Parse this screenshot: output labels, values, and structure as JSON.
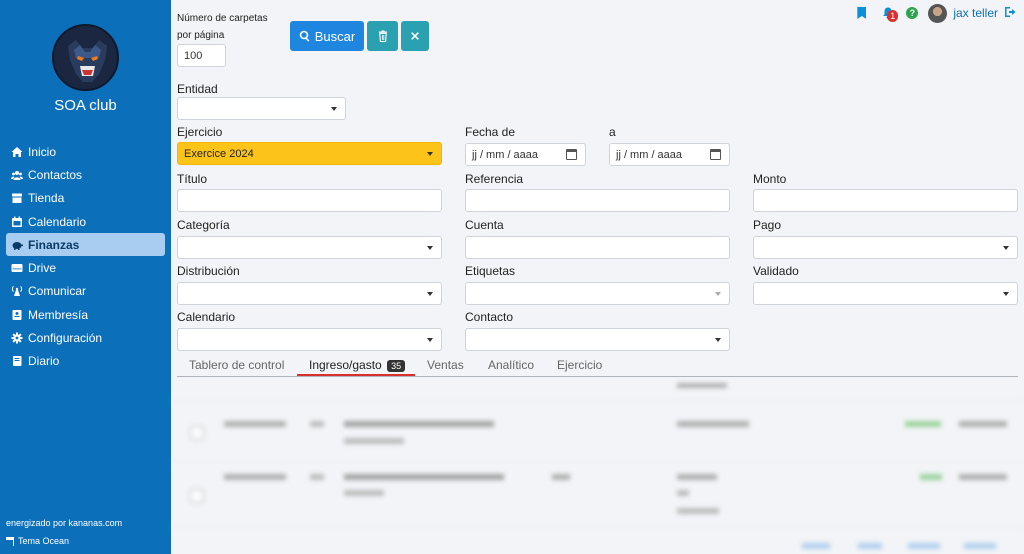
{
  "sidebar": {
    "club_name": "SOA club",
    "items": [
      {
        "label": "Inicio",
        "icon": "home-icon"
      },
      {
        "label": "Contactos",
        "icon": "users-icon"
      },
      {
        "label": "Tienda",
        "icon": "store-icon"
      },
      {
        "label": "Calendario",
        "icon": "calendar-icon"
      },
      {
        "label": "Finanzas",
        "icon": "piggy-bank-icon",
        "active": true
      },
      {
        "label": "Drive",
        "icon": "hdd-icon"
      },
      {
        "label": "Comunicar",
        "icon": "broadcast-icon"
      },
      {
        "label": "Membresía",
        "icon": "id-card-icon"
      },
      {
        "label": "Configuración",
        "icon": "gear-icon"
      },
      {
        "label": "Diario",
        "icon": "book-icon"
      }
    ],
    "powered_by": "energizado por kananas.com",
    "theme": "Tema Ocean"
  },
  "topbar": {
    "notifications_count": "1",
    "help": "?",
    "user_name": "jax teller"
  },
  "filters": {
    "per_page_label": "Número de carpetas por página",
    "per_page_line1": "Número de carpetas",
    "per_page_line2": "por página",
    "per_page_value": "100",
    "search_button": "Buscar",
    "entidad_label": "Entidad",
    "ejercicio_label": "Ejercicio",
    "ejercicio_value": "Exercice 2024",
    "fecha_de_label": "Fecha de",
    "fecha_de_placeholder": "jj / mm / aaaa",
    "a_label": "a",
    "a_placeholder": "jj / mm / aaaa",
    "titulo_label": "Título",
    "referencia_label": "Referencia",
    "monto_label": "Monto",
    "categoria_label": "Categoría",
    "cuenta_label": "Cuenta",
    "pago_label": "Pago",
    "distribucion_label": "Distribución",
    "etiquetas_label": "Etiquetas",
    "validado_label": "Validado",
    "calendario_label": "Calendario",
    "contacto_label": "Contacto"
  },
  "tabs": {
    "dashboard": "Tablero de control",
    "income_expense": "Ingreso/gasto",
    "income_expense_count": "35",
    "sales": "Ventas",
    "analytics": "Analítico",
    "fiscal_year": "Ejercicio"
  },
  "colors": {
    "sidebar": "#0b6fba",
    "primary": "#1f86e0",
    "teal": "#2aa1b1",
    "highlight_yellow": "#fcc419",
    "active_tab": "#d9302f"
  }
}
